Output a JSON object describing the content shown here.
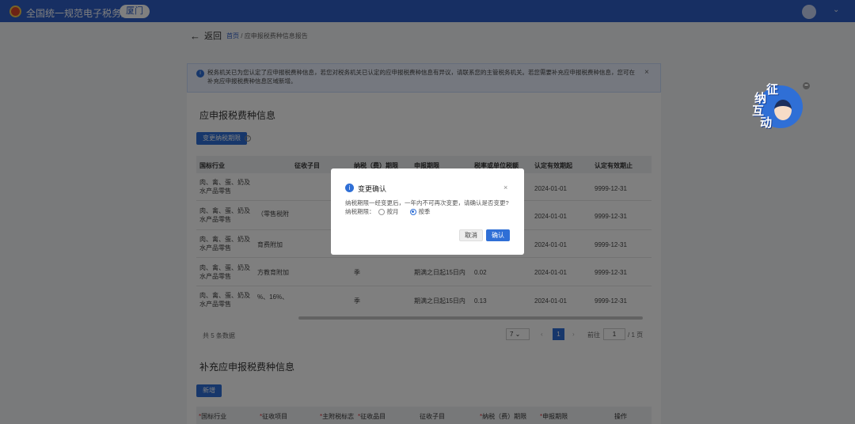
{
  "header": {
    "app_title": "全国统一规范电子税务局",
    "city": "厦门"
  },
  "nav": {
    "back_label": "返回",
    "breadcrumb_home": "首页",
    "breadcrumb_sep": "/",
    "breadcrumb_current": "应申报税费种信息报告"
  },
  "notice": {
    "text": "税务机关已为您认定了应申报税费种信息，若您对税务机关已认定的应申报税费种信息有异议，请联系您的主管税务机关。若您需要补充应申报税费种信息，您可在补充应申报税费种信息区域新增。",
    "close": "×"
  },
  "section1": {
    "title": "应申报税费种信息",
    "change_button": "变更纳税期限",
    "columns": [
      "国标行业",
      "征收子目",
      "纳税（费）期限",
      "申报期限",
      "税率或单位税额",
      "认定有效期起",
      "认定有效期止"
    ],
    "rows": [
      {
        "industry": "肉、禽、蛋、奶及水产品零售",
        "subitem": "",
        "period": "",
        "deadline": "",
        "rate": "",
        "start": "2024-01-01",
        "end": "9999-12-31"
      },
      {
        "industry": "肉、禽、蛋、奶及水产品零售",
        "subitem": "（零售税附",
        "period": "",
        "deadline": "",
        "rate": "",
        "start": "2024-01-01",
        "end": "9999-12-31"
      },
      {
        "industry": "肉、禽、蛋、奶及水产品零售",
        "subitem": "育费附加",
        "period": "",
        "deadline": "",
        "rate": "",
        "start": "2024-01-01",
        "end": "9999-12-31"
      },
      {
        "industry": "肉、禽、蛋、奶及水产品零售",
        "subitem": "方教育附加",
        "period": "季",
        "deadline": "期满之日起15日内",
        "rate": "0.02",
        "start": "2024-01-01",
        "end": "9999-12-31"
      },
      {
        "industry": "肉、禽、蛋、奶及水产品零售",
        "subitem": "%、16%、",
        "period": "季",
        "deadline": "期满之日起15日内",
        "rate": "0.13",
        "start": "2024-01-01",
        "end": "9999-12-31"
      }
    ],
    "total": "共 5 条数据",
    "page_size": "7",
    "current_page": "1",
    "goto_label": "前往",
    "goto_value": "1",
    "total_pages": "/ 1 页"
  },
  "section2": {
    "title": "补充应申报税费种信息",
    "add_button": "新增",
    "columns": [
      "国标行业",
      "征收项目",
      "主附税标志",
      "征收品目",
      "征收子目",
      "纳税（费）期限",
      "申报期限",
      "操作"
    ]
  },
  "modal": {
    "title": "变更确认",
    "close": "×",
    "body": "纳税期限一经变更后，一年内不可再次变更，请确认是否变更?",
    "radio_label": "纳税期限：",
    "option_month": "按月",
    "option_quarter": "按季",
    "selected": "按季",
    "cancel": "取消",
    "confirm": "确认"
  },
  "mascot": {
    "chars": [
      "征",
      "纳",
      "互",
      "动"
    ],
    "minimize": "−"
  }
}
